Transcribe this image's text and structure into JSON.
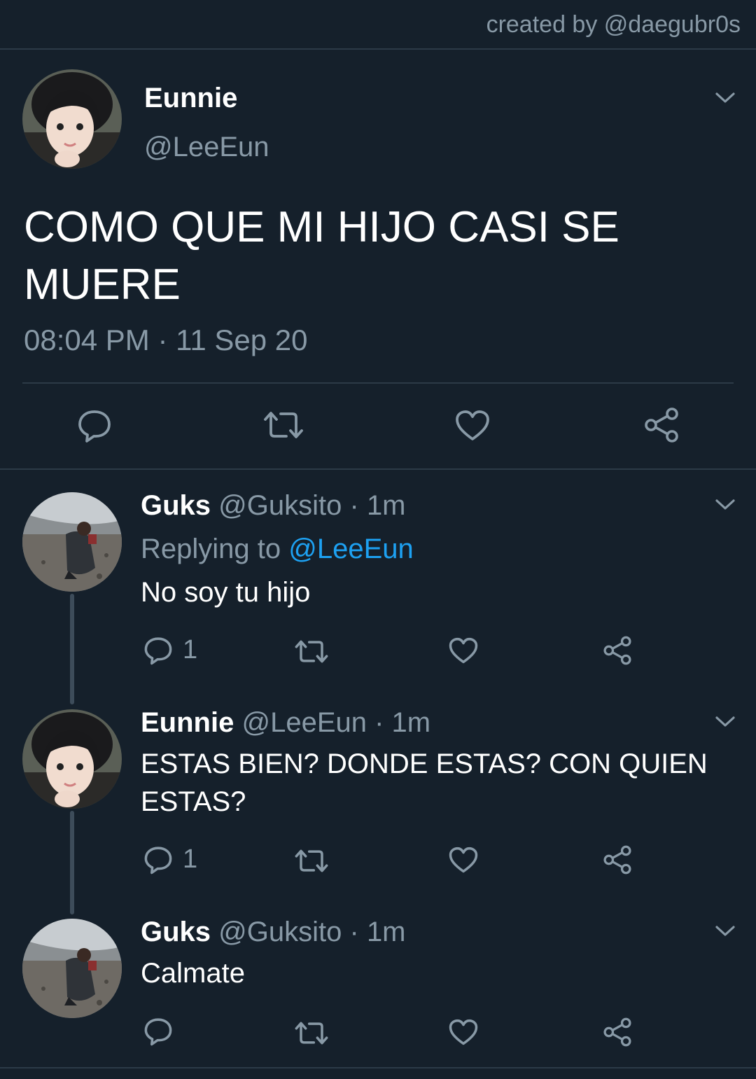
{
  "credit": "created by @daegubr0s",
  "tweet": {
    "name": "Eunnie",
    "handle": "@LeeEun",
    "text": "COMO QUE MI HIJO CASI SE MUERE",
    "time": "08:04 PM",
    "separator": "·",
    "date": "11 Sep 20"
  },
  "replies": [
    {
      "name": "Guks",
      "handle": "@Guksito",
      "time": "1m",
      "replying_prefix": "Replying to",
      "replying_to": "@LeeEun",
      "text": "No soy tu hijo",
      "reply_count": "1"
    },
    {
      "name": "Eunnie",
      "handle": "@LeeEun",
      "time": "1m",
      "text": "ESTAS BIEN? DONDE ESTAS? CON QUIEN ESTAS?",
      "reply_count": "1"
    },
    {
      "name": "Guks",
      "handle": "@Guksito",
      "time": "1m",
      "text": "Calmate"
    }
  ],
  "dot": " · ",
  "colors": {
    "background": "#15202b",
    "secondary_text": "#8899a6",
    "link": "#1da1f2",
    "divider": "#2c3a47"
  },
  "icons": [
    "reply-icon",
    "retweet-icon",
    "like-icon",
    "share-icon",
    "chevron-down-icon"
  ]
}
